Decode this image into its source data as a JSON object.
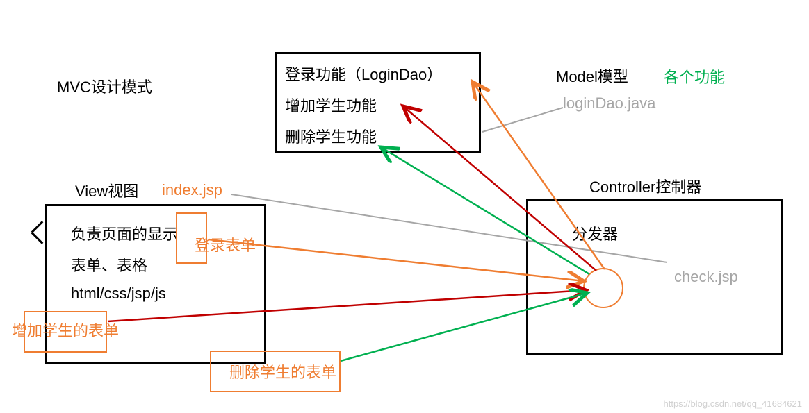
{
  "title": "MVC设计模式",
  "model": {
    "heading": "Model模型",
    "annotation": "各个功能",
    "file": "loginDao.java",
    "items": {
      "login": "登录功能（LoginDao）",
      "add": "增加学生功能",
      "delete": "删除学生功能"
    }
  },
  "view": {
    "heading": "View视图",
    "file": "index.jsp",
    "items": {
      "display": "负责页面的显示",
      "forms": "表单、表格",
      "tech": "html/css/jsp/js"
    },
    "forms": {
      "login": "登录表单",
      "add": "增加学生的表单",
      "delete": "删除学生的表单"
    }
  },
  "controller": {
    "heading": "Controller控制器",
    "dispatcher": "分发器",
    "file": "check.jsp"
  },
  "watermark": "https://blog.csdn.net/qq_41684621"
}
